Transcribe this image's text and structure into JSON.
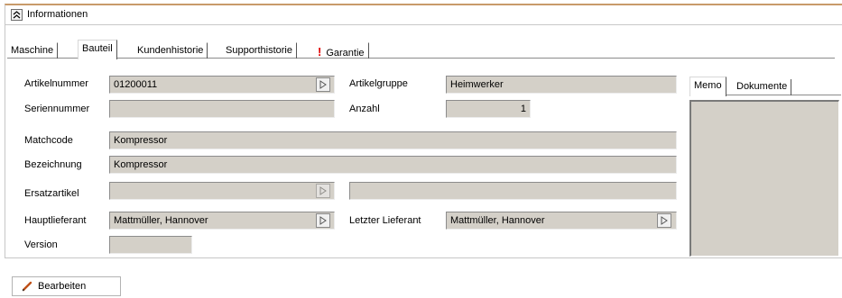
{
  "panel": {
    "title": "Informationen"
  },
  "tabs": [
    {
      "label": "Maschine"
    },
    {
      "label": "Bauteil"
    },
    {
      "label": "Kundenhistorie"
    },
    {
      "label": "Supporthistorie"
    },
    {
      "label": "Garantie",
      "icon": "warning-exclamation-icon"
    }
  ],
  "active_tab": "Bauteil",
  "form": {
    "artikelnummer": {
      "label": "Artikelnummer",
      "value": "01200011"
    },
    "seriennummer": {
      "label": "Seriennummer",
      "value": ""
    },
    "artikelgruppe": {
      "label": "Artikelgruppe",
      "value": "Heimwerker"
    },
    "anzahl": {
      "label": "Anzahl",
      "value": "1"
    },
    "matchcode": {
      "label": "Matchcode",
      "value": "Kompressor"
    },
    "bezeichnung": {
      "label": "Bezeichnung",
      "value": "Kompressor"
    },
    "ersatzartikel": {
      "label": "Ersatzartikel",
      "value": "",
      "description": ""
    },
    "hauptlieferant": {
      "label": "Hauptlieferant",
      "value": "Mattmüller, Hannover"
    },
    "letzter_lieferant": {
      "label": "Letzter Lieferant",
      "value": "Mattmüller, Hannover"
    },
    "version": {
      "label": "Version",
      "value": ""
    }
  },
  "memo_tabs": [
    {
      "label": "Memo"
    },
    {
      "label": "Dokumente"
    }
  ],
  "memo_active_tab": "Memo",
  "memo_text": "",
  "actions": {
    "edit_label": "Bearbeiten",
    "edit_icon": "pencil-icon"
  },
  "colors": {
    "field_bg": "#d4d0c8",
    "panel_accent": "#c89a6a",
    "warning": "#e00000"
  }
}
